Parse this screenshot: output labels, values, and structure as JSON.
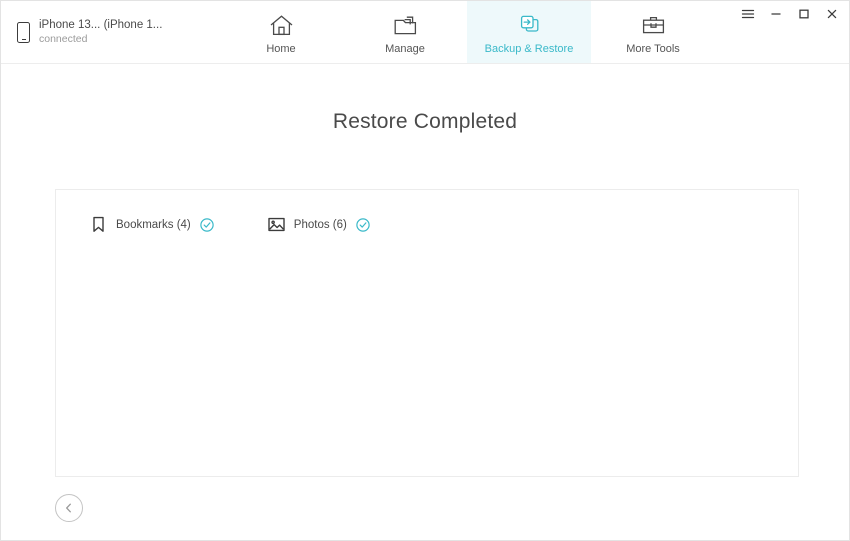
{
  "window": {
    "controls": [
      {
        "name": "menu",
        "glyph": "menu-icon"
      },
      {
        "name": "minimize",
        "glyph": "minimize-icon"
      },
      {
        "name": "maximize",
        "glyph": "maximize-icon"
      },
      {
        "name": "close",
        "glyph": "close-icon"
      }
    ]
  },
  "device": {
    "name": "iPhone 13... (iPhone 1...",
    "status": "connected"
  },
  "nav": {
    "tabs": [
      {
        "label": "Home",
        "icon": "home-icon",
        "active": false
      },
      {
        "label": "Manage",
        "icon": "folder-icon",
        "active": false
      },
      {
        "label": "Backup & Restore",
        "icon": "backup-restore-icon",
        "active": true
      },
      {
        "label": "More Tools",
        "icon": "toolbox-icon",
        "active": false
      }
    ]
  },
  "main": {
    "title": "Restore Completed",
    "restored_items": [
      {
        "label": "Bookmarks (4)",
        "icon": "bookmark-icon",
        "status": "completed"
      },
      {
        "label": "Photos (6)",
        "icon": "photo-icon",
        "status": "completed"
      }
    ]
  },
  "footer": {
    "back_label": "Back"
  },
  "colors": {
    "accent": "#3ab9c9",
    "accent_bg": "#eef9fb",
    "text": "#4a4a4a",
    "muted": "#9b9b9b",
    "border": "#ececec"
  }
}
